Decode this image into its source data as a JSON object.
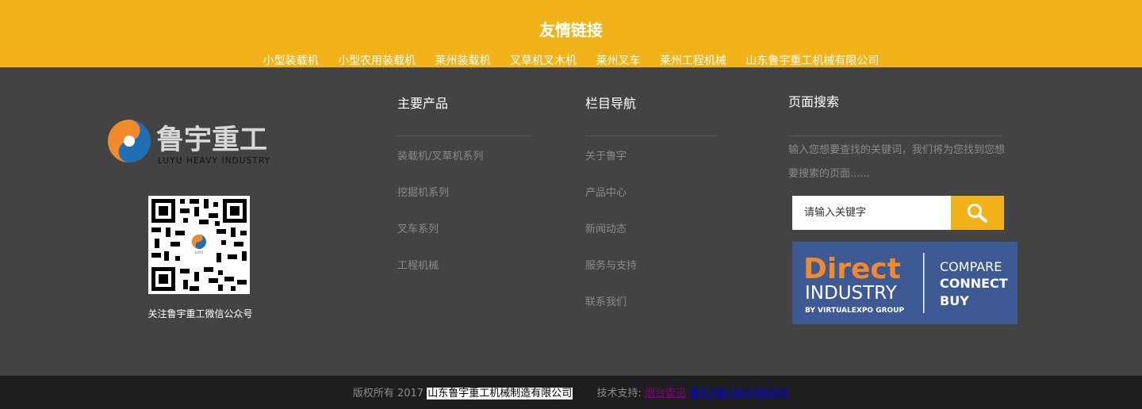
{
  "friend_links": {
    "title": "友情链接",
    "items": [
      "小型装载机",
      "小型农用装载机",
      "莱州装载机",
      "叉草机叉木机",
      "莱州叉车",
      "莱州工程机械",
      "山东鲁宇重工机械有限公司"
    ]
  },
  "logo": {
    "cn": "鲁宇重工",
    "en": "LUYU HEAVY INDUSTRY"
  },
  "qr": {
    "caption": "关注鲁宇重工微信公众号",
    "badge": "LUYU"
  },
  "products": {
    "title": "主要产品",
    "items": [
      "装载机/叉草机系列",
      "挖掘机系列",
      "叉车系列",
      "工程机械"
    ]
  },
  "nav": {
    "title": "栏目导航",
    "items": [
      "关于鲁宇",
      "产品中心",
      "新闻动态",
      "服务与支持",
      "联系我们"
    ]
  },
  "search": {
    "title": "页面搜索",
    "desc": "输入您想要查找的关键词，我们将为您找到您想要搜索的页面......",
    "placeholder": "请输入关键字"
  },
  "banner": {
    "word1": "Direct",
    "word2": "INDUSTRY",
    "byline": "BY VIRTUALEXPO GROUP",
    "l1": "COMPARE",
    "l2": "CONNECT",
    "l3": "BUY"
  },
  "footer": {
    "copyright": "版权所有 2017",
    "company": "山东鲁宇重工机械制造有限公司",
    "tech_label": "技术支持:",
    "tech_link": "烟台雷迅",
    "icp": "鲁ICP备18019808号"
  },
  "colors": {
    "accent": "#f2b31a",
    "panel": "#434343",
    "bottom": "#1e1e1e",
    "banner": "#3d5a94",
    "banner_orange": "#f08a2a",
    "logo_blue": "#1f6fb5"
  }
}
